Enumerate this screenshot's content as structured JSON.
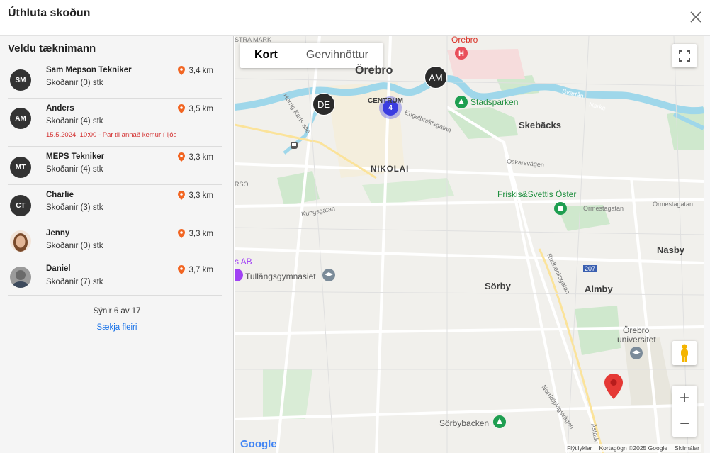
{
  "dialog": {
    "title": "Úthluta skoðun",
    "close_icon": "close-icon"
  },
  "sidebar": {
    "heading": "Veldu tæknimann",
    "technicians": [
      {
        "initials": "SM",
        "name": "Sam Mepson Tekniker",
        "sub": "Skoðanir (0) stk",
        "distance": "3,4 km",
        "warning": ""
      },
      {
        "initials": "AM",
        "name": "Anders",
        "sub": "Skoðanir (4) stk",
        "distance": "3,5 km",
        "warning": "15.5.2024, 10:00 - Par til annað kemur í ljós"
      },
      {
        "initials": "MT",
        "name": "MEPS Tekniker",
        "sub": "Skoðanir (4) stk",
        "distance": "3,3 km",
        "warning": ""
      },
      {
        "initials": "CT",
        "name": "Charlie",
        "sub": "Skoðanir (3) stk",
        "distance": "3,3 km",
        "warning": ""
      },
      {
        "initials": "",
        "name": "Jenny",
        "sub": "Skoðanir (0) stk",
        "distance": "3,3 km",
        "warning": ""
      },
      {
        "initials": "",
        "name": "Daniel",
        "sub": "Skoðanir (7) stk",
        "distance": "3,7 km",
        "warning": ""
      }
    ],
    "count": "Sýnir 6 av 17",
    "load_more": "Sækja fleiri"
  },
  "map": {
    "type_tabs": {
      "map": "Kort",
      "satellite": "Gervihnöttur"
    },
    "markers": {
      "de": "DE",
      "am": "AM",
      "cluster": "4"
    },
    "labels": {
      "orebro_city": "Örebro",
      "orebro_hospital": "Örebro",
      "centrum": "CENTRUM",
      "nikolai": "NIKOLAI",
      "skebacks": "Skebäcks",
      "stadsparken": "Stadsparken",
      "friskis": "Friskis&Svettis Öster",
      "nasby": "Näsby",
      "almby": "Almby",
      "sorby": "Sörby",
      "tullangs": "Tullängsgymnasiet",
      "ab": "s AB",
      "universitet1": "Örebro",
      "universitet2": "universitet",
      "sorbybacken": "Sörbybacken",
      "stra_mark": "STRA MARK",
      "rso": "RSO",
      "engelbrektsgatan": "Engelbrektsgatan",
      "oskarsvagen": "Oskarsvägen",
      "kungsgatan": "Kungsgatan",
      "ormestagatan1": "Ormestagatan",
      "ormestagatan2": "Ormestagatan",
      "svartan": "Svartån",
      "narke": "Närke",
      "herrig": "Herrig Karls alle",
      "rudbecksgatan": "Rudbecksgatan",
      "norrkoping": "Norrköpingsvägen",
      "astad": "Åstadv",
      "route": "207"
    },
    "attribution": {
      "shortcuts": "Flýtilyklar",
      "data": "Kortagögn ©2025 Google",
      "terms": "Skilmálar"
    },
    "google": "Google",
    "zoom_in": "+",
    "zoom_out": "−"
  }
}
